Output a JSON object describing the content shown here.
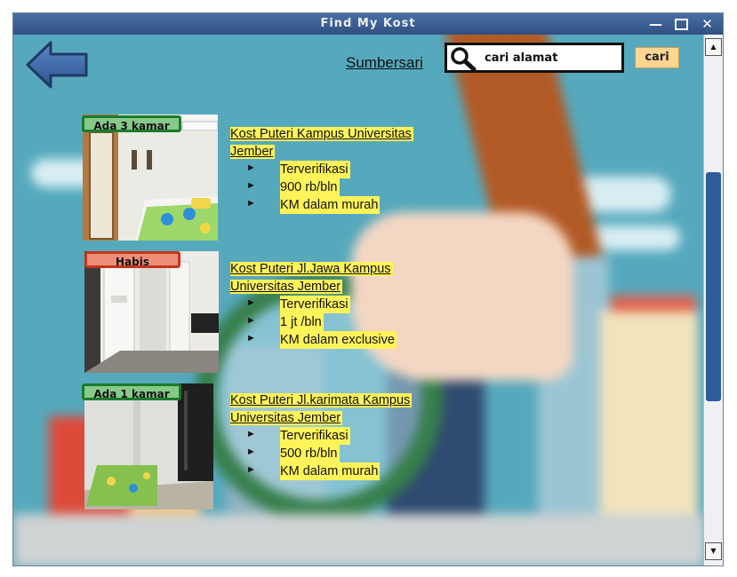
{
  "window": {
    "title": "Find My Kost"
  },
  "header": {
    "location": "Sumbersari"
  },
  "search": {
    "placeholder": "cari alamat",
    "button_label": "cari"
  },
  "listings": [
    {
      "badge": "Ada 3 kamar",
      "badge_status": "available",
      "title_line1": "Kost Puteri Kampus Universitas",
      "title_line2": "Jember",
      "features": [
        "Terverifikasi",
        "900 rb/bln",
        "KM dalam murah"
      ]
    },
    {
      "badge": "Habis",
      "badge_status": "sold-out",
      "title_line1": "Kost Puteri Jl.Jawa Kampus",
      "title_line2": "Universitas Jember",
      "features": [
        "Terverifikasi",
        "1 jt /bln",
        "KM dalam exclusive"
      ]
    },
    {
      "badge": "Ada 1 kamar",
      "badge_status": "available",
      "title_line1": "Kost Puteri Jl.karimata Kampus",
      "title_line2": "Universitas Jember",
      "features": [
        "Terverifikasi",
        "500 rb/bln",
        "KM dalam murah"
      ]
    }
  ],
  "colors": {
    "titlebar": "#2f4f80",
    "highlight": "#fff35a",
    "badge_available": "#86c989",
    "badge_sold_out": "#ef8e76",
    "search_button": "#ffd592"
  }
}
